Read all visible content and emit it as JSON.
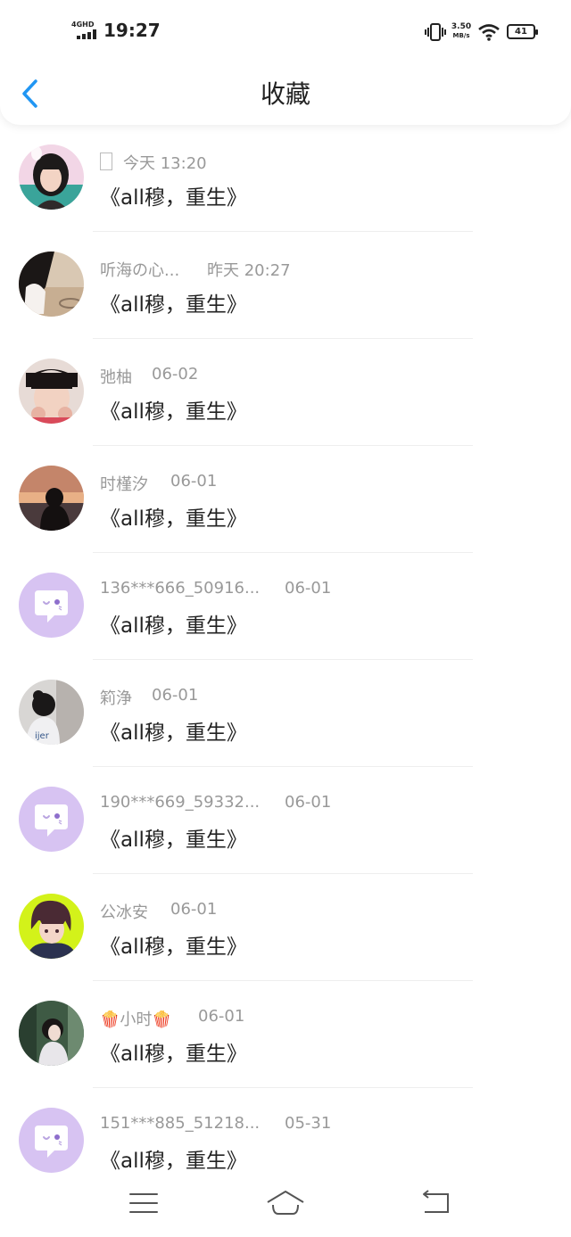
{
  "status_bar": {
    "network": "4GHD",
    "time": "19:27",
    "speed_value": "3.50",
    "speed_unit": "MB/s",
    "battery": "41"
  },
  "header": {
    "title": "收藏",
    "back_icon": "chevron-left-icon"
  },
  "colors": {
    "accent": "#2196f3",
    "text_primary": "#222222",
    "text_secondary": "#999999",
    "placeholder_avatar": "#d7c3f2"
  },
  "items": [
    {
      "username": "",
      "time": "今天 13:20",
      "title": "《all穆，重生》",
      "avatar": "photo-girl-icon"
    },
    {
      "username": "听海の心...",
      "time": "昨天 20:27",
      "title": "《all穆，重生》",
      "avatar": "photo-beach-icon"
    },
    {
      "username": "弛柚",
      "time": "06-02",
      "title": "《all穆，重生》",
      "avatar": "photo-boy-icon"
    },
    {
      "username": "时槿汐",
      "time": "06-01",
      "title": "《all穆，重生》",
      "avatar": "photo-sunset-icon"
    },
    {
      "username": "136***666_50916...",
      "time": "06-01",
      "title": "《all穆，重生》",
      "avatar": "default-chat-avatar-icon"
    },
    {
      "username": "筣浄",
      "time": "06-01",
      "title": "《all穆，重生》",
      "avatar": "photo-girl-back-icon"
    },
    {
      "username": "190***669_59332...",
      "time": "06-01",
      "title": "《all穆，重生》",
      "avatar": "default-chat-avatar-icon"
    },
    {
      "username": "公冰安",
      "time": "06-01",
      "title": "《all穆，重生》",
      "avatar": "anime-avatar-icon"
    },
    {
      "username": "🍿小时🍿",
      "time": "06-01",
      "title": "《all穆，重生》",
      "avatar": "photo-forest-icon"
    },
    {
      "username": "151***885_51218...",
      "time": "05-31",
      "title": "《all穆，重生》",
      "avatar": "default-chat-avatar-icon"
    }
  ],
  "nav_bar": {
    "menu_icon": "menu-icon",
    "home_icon": "home-icon",
    "back_icon": "back-arrow-icon"
  }
}
